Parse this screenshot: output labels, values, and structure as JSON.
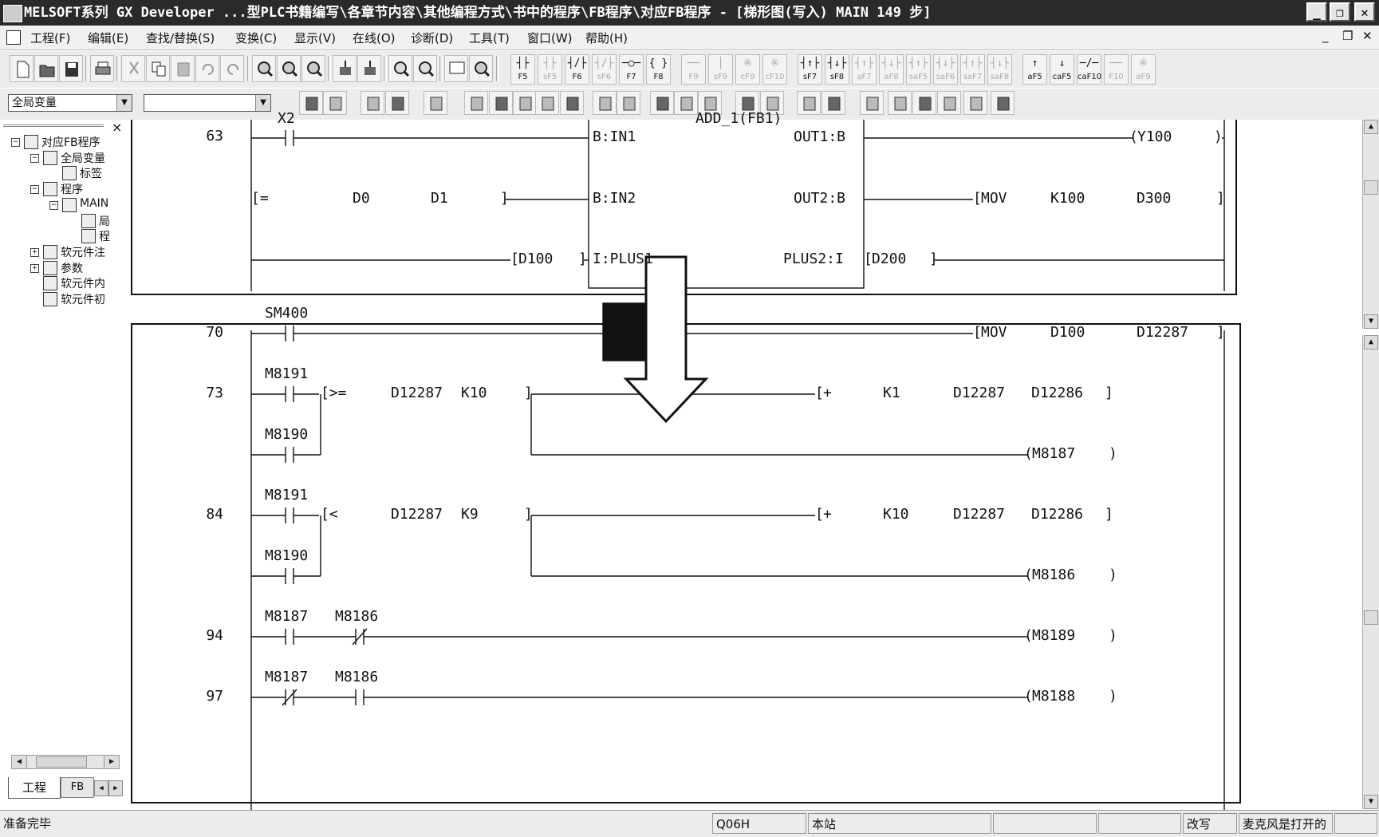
{
  "window": {
    "title": "MELSOFT系列 GX Developer ...型PLC书籍编写\\各章节内容\\其他编程方式\\书中的程序\\FB程序\\对应FB程序 - [梯形图(写入)      MAIN      149 步]",
    "minimize": "_",
    "restore": "❐",
    "close": "✕"
  },
  "menu": {
    "items": [
      "工程(F)",
      "编辑(E)",
      "查找/替换(S)",
      "变换(C)",
      "显示(V)",
      "在线(O)",
      "诊断(D)",
      "工具(T)",
      "窗口(W)",
      "帮助(H)"
    ],
    "mdi_min": "_",
    "mdi_restore": "❐",
    "mdi_close": "✕"
  },
  "ladder_keys": [
    {
      "sym": "┤├",
      "key": "F5"
    },
    {
      "sym": "┤├",
      "key": "sF5"
    },
    {
      "sym": "┤/├",
      "key": "F6"
    },
    {
      "sym": "┤/├",
      "key": "sF6"
    },
    {
      "sym": "─○─",
      "key": "F7"
    },
    {
      "sym": "{ }",
      "key": "F8"
    },
    {
      "sym": "──",
      "key": "F9"
    },
    {
      "sym": "│",
      "key": "sF9"
    },
    {
      "sym": "※",
      "key": "cF9"
    },
    {
      "sym": "※",
      "key": "cF10"
    },
    {
      "sym": "┤↑├",
      "key": "sF7"
    },
    {
      "sym": "┤↓├",
      "key": "sF8"
    },
    {
      "sym": "┤↑├",
      "key": "aF7"
    },
    {
      "sym": "┤↓├",
      "key": "aF8"
    },
    {
      "sym": "┤↑├",
      "key": "saF5"
    },
    {
      "sym": "┤↓├",
      "key": "saF6"
    },
    {
      "sym": "┤↑├",
      "key": "saF7"
    },
    {
      "sym": "┤↓├",
      "key": "saF8"
    },
    {
      "sym": "↑",
      "key": "aF5"
    },
    {
      "sym": "↓",
      "key": "caF5"
    },
    {
      "sym": "─/─",
      "key": "caF10"
    },
    {
      "sym": "──",
      "key": "F10"
    },
    {
      "sym": "※",
      "key": "aF9"
    }
  ],
  "combos": {
    "scope": "全局变量",
    "second": ""
  },
  "project_tree": {
    "close_label": "×",
    "items": [
      {
        "label": "对应FB程序",
        "level": 0,
        "pm": "−"
      },
      {
        "label": "全局变量",
        "level": 1,
        "pm": "−"
      },
      {
        "label": "标签",
        "level": 2,
        "pm": ""
      },
      {
        "label": "程序",
        "level": 1,
        "pm": "−"
      },
      {
        "label": "MAIN",
        "level": 2,
        "pm": "−"
      },
      {
        "label": "局",
        "level": 3,
        "pm": ""
      },
      {
        "label": "程",
        "level": 3,
        "pm": ""
      },
      {
        "label": "软元件注",
        "level": 1,
        "pm": "+"
      },
      {
        "label": "参数",
        "level": 1,
        "pm": "+"
      },
      {
        "label": "软元件内",
        "level": 1,
        "pm": ""
      },
      {
        "label": "软元件初",
        "level": 1,
        "pm": ""
      }
    ],
    "tabs": [
      "工程",
      "FB"
    ]
  },
  "ladder_top": {
    "step_numbers": [
      "63"
    ],
    "contact": "X2",
    "fb_title": "ADD_1(FB1)",
    "fb_inputs": [
      "B:IN1",
      "B:IN2",
      "I:PLUS1"
    ],
    "fb_outputs": [
      "OUT1:B",
      "OUT2:B",
      "PLUS2:I"
    ],
    "compare": {
      "op": "[=",
      "a": "D0",
      "b": "D1"
    },
    "in_dev": "D100",
    "out_dev": "D200",
    "coil": "Y100",
    "mov": {
      "op": "MOV",
      "a": "K100",
      "b": "D300"
    }
  },
  "ladder_bottom": {
    "rungs": [
      {
        "step": "70",
        "contacts": [
          "SM400"
        ],
        "instr": [
          "MOV",
          "D100",
          "D12287"
        ]
      },
      {
        "step": "73",
        "contacts": [
          "M8191",
          "M8190"
        ],
        "compare": [
          "[>=",
          "D12287",
          "K10"
        ],
        "instr": [
          "+",
          "K1",
          "D12287",
          "D12286"
        ],
        "coil": "M8187"
      },
      {
        "step": "84",
        "contacts": [
          "M8191",
          "M8190"
        ],
        "compare": [
          "[<",
          "D12287",
          "K9"
        ],
        "instr": [
          "+",
          "K10",
          "D12287",
          "D12286"
        ],
        "coil": "M8186"
      },
      {
        "step": "94",
        "contacts": [
          "M8187",
          "M8186"
        ],
        "coil": "M8189"
      },
      {
        "step": "97",
        "contacts": [
          "M8187",
          "M8186"
        ],
        "coil": "M8188"
      }
    ]
  },
  "status": {
    "ready": "准备完毕",
    "cpu": "Q06H",
    "station": "本站",
    "mode": "改写",
    "mic": "麦克风是打开的"
  }
}
